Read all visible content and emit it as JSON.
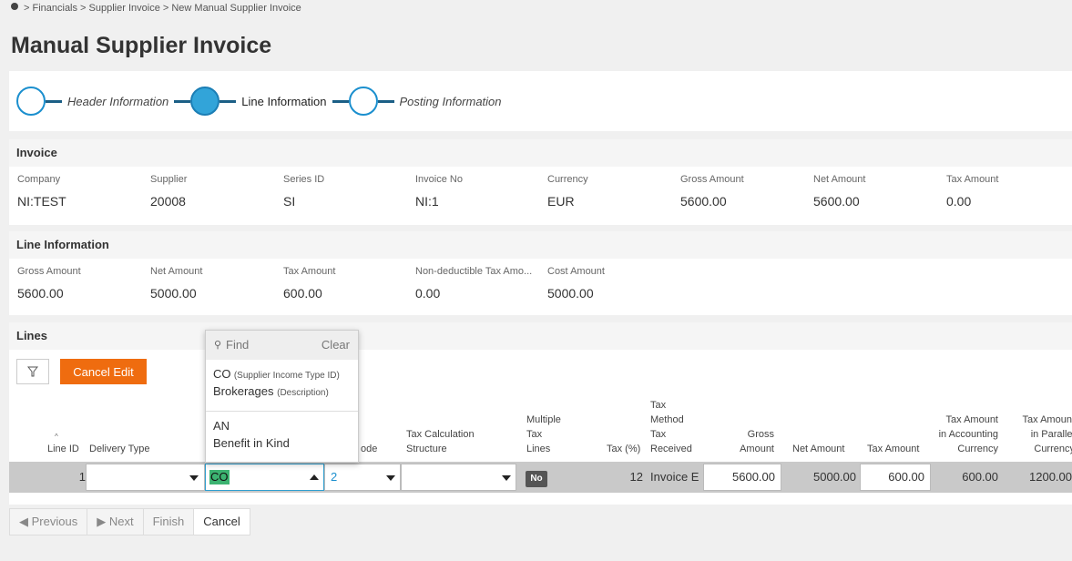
{
  "breadcrumb": {
    "path": "> Financials > Supplier Invoice > New Manual Supplier Invoice"
  },
  "page": {
    "title": "Manual Supplier Invoice"
  },
  "steps": [
    {
      "label": "Header Information"
    },
    {
      "label": "Line Information"
    },
    {
      "label": "Posting Information"
    }
  ],
  "invoice": {
    "title": "Invoice",
    "fields": [
      {
        "label": "Company",
        "value": "NI:TEST"
      },
      {
        "label": "Supplier",
        "value": "20008"
      },
      {
        "label": "Series ID",
        "value": "SI"
      },
      {
        "label": "Invoice No",
        "value": "NI:1"
      },
      {
        "label": "Currency",
        "value": "EUR"
      },
      {
        "label": "Gross Amount",
        "value": "5600.00"
      },
      {
        "label": "Net Amount",
        "value": "5600.00"
      },
      {
        "label": "Tax Amount",
        "value": "0.00"
      }
    ]
  },
  "line_info": {
    "title": "Line Information",
    "fields": [
      {
        "label": "Gross Amount",
        "value": "5600.00"
      },
      {
        "label": "Net Amount",
        "value": "5000.00"
      },
      {
        "label": "Tax Amount",
        "value": "600.00"
      },
      {
        "label": "Non-deductible Tax Amo...",
        "value": "0.00"
      },
      {
        "label": "Cost Amount",
        "value": "5000.00"
      }
    ]
  },
  "lines": {
    "title": "Lines",
    "cancel_edit": "Cancel Edit",
    "columns": {
      "line_id": "Line ID",
      "delivery_type": "Delivery Type",
      "code_suffix": "ode",
      "tax_calc_1": "Tax Calculation",
      "tax_calc_2": "Structure",
      "multi_1": "Multiple",
      "multi_2": "Tax",
      "multi_3": "Lines",
      "tax_pct": "Tax (%)",
      "method_1": "Tax",
      "method_2": "Method",
      "method_3": "Tax",
      "method_4": "Received",
      "gross_1": "Gross",
      "gross_2": "Amount",
      "net": "Net Amount",
      "tax_amount": "Tax Amount",
      "acc_1": "Tax Amount",
      "acc_2": "in Accounting",
      "acc_3": "Currency",
      "par_1": "Tax Amount",
      "par_2": "in Parallel",
      "par_3": "Currency"
    },
    "row": {
      "line_id": "1",
      "delivery_type": "",
      "income_type": "CO",
      "code": "2",
      "tax_calc": "",
      "multiple_tax": "No",
      "tax_pct": "12",
      "tax_method": "Invoice E",
      "gross": "5600.00",
      "net": "5000.00",
      "tax_amount": "600.00",
      "tax_acc": "600.00",
      "tax_par": "1200.00"
    }
  },
  "dropdown": {
    "find": "Find",
    "clear": "Clear",
    "items": [
      {
        "code": "CO",
        "code_hint": "(Supplier Income Type ID)",
        "desc": "Brokerages",
        "desc_hint": "(Description)"
      },
      {
        "code": "AN",
        "desc": "Benefit in Kind"
      }
    ]
  },
  "nav": {
    "previous": "Previous",
    "next": "Next",
    "finish": "Finish",
    "cancel": "Cancel"
  },
  "colors": {
    "accent": "#ef6c0f",
    "step": "#32a4d9",
    "highlight": "#3cb371"
  }
}
